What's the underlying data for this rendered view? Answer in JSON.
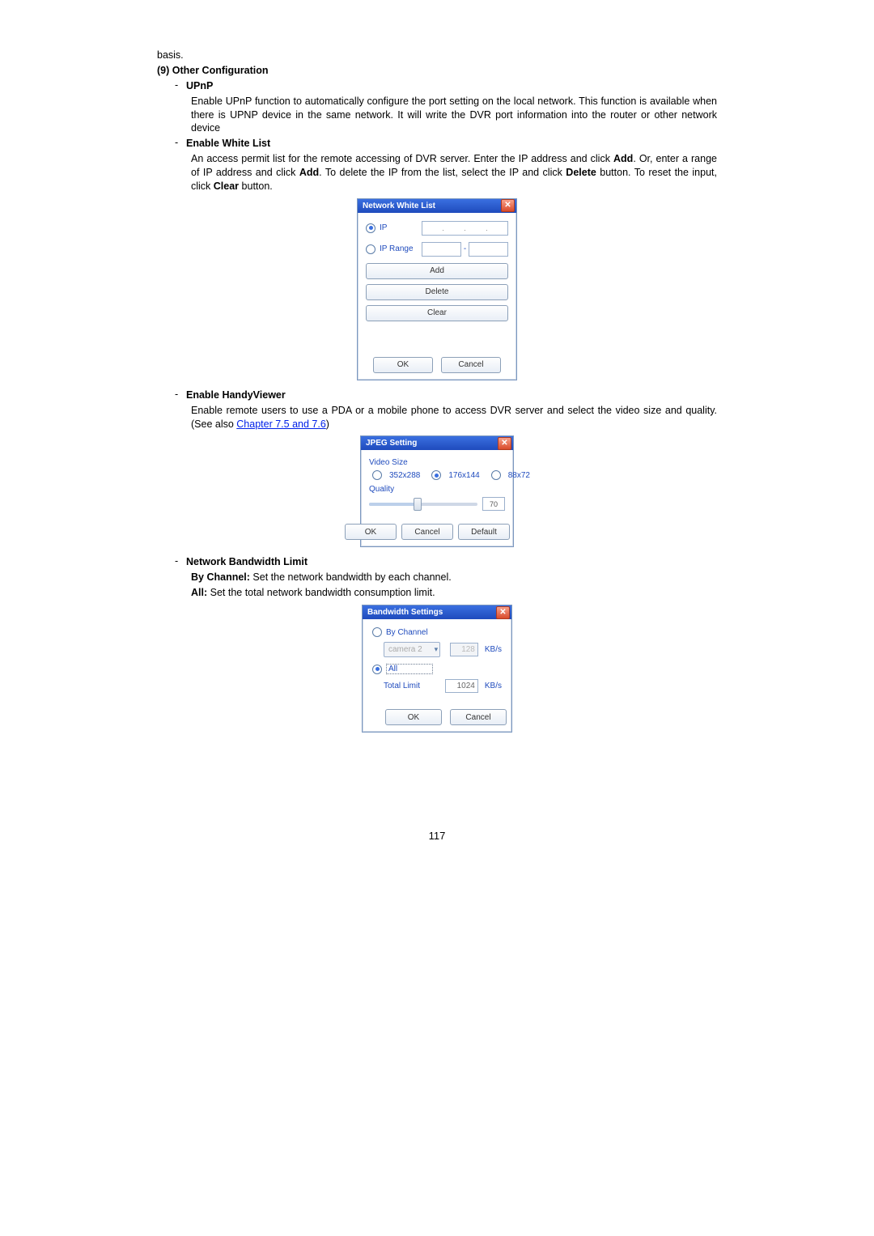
{
  "text": {
    "basis": "basis.",
    "section_title": "(9) Other Configuration",
    "upnp_title": "UPnP",
    "upnp_body": "Enable UPnP function to automatically configure the port setting on the local network. This function is available when there is UPNP device in the same network. It will write the DVR port information into the router or other network device",
    "ewl_title": "Enable White List",
    "ewl_body_1": "An access permit list for the remote accessing of DVR server. Enter the IP address and click ",
    "ewl_add": "Add",
    "ewl_body_2": ". Or, enter a range of IP address and click ",
    "ewl_body_3": ". To delete the IP from the list, select the IP and click ",
    "ewl_delete": "Delete",
    "ewl_body_4": " button. To reset the input, click ",
    "ewl_clear": "Clear",
    "ewl_body_5": " button.",
    "ehv_title": "Enable HandyViewer",
    "ehv_body_1": "Enable remote users to use a PDA or a mobile phone to access DVR server and select the video size and quality. (See also ",
    "ehv_link": "Chapter 7.5 and 7.6",
    "ehv_body_2": ")",
    "nbl_title": "Network Bandwidth Limit",
    "nbl_bych_lbl": "By Channel:",
    "nbl_bych_txt": " Set the network bandwidth by each channel.",
    "nbl_all_lbl": "All:",
    "nbl_all_txt": " Set the total network bandwidth consumption limit.",
    "page_number": "117"
  },
  "nwl_dialog": {
    "title": "Network White List",
    "ip_label": "IP",
    "iprange_label": "IP Range",
    "btn_add": "Add",
    "btn_delete": "Delete",
    "btn_clear": "Clear",
    "btn_ok": "OK",
    "btn_cancel": "Cancel"
  },
  "jpeg_dialog": {
    "title": "JPEG Setting",
    "video_size": "Video Size",
    "opt1": "352x288",
    "opt2": "176x144",
    "opt3": "88x72",
    "quality": "Quality",
    "quality_value": "70",
    "btn_ok": "OK",
    "btn_cancel": "Cancel",
    "btn_default": "Default"
  },
  "bw_dialog": {
    "title": "Bandwidth Settings",
    "by_channel": "By Channel",
    "camera": "camera 2",
    "bych_val": "128",
    "all": "All",
    "total_limit": "Total Limit",
    "total_val": "1024",
    "unit": "KB/s",
    "btn_ok": "OK",
    "btn_cancel": "Cancel"
  }
}
